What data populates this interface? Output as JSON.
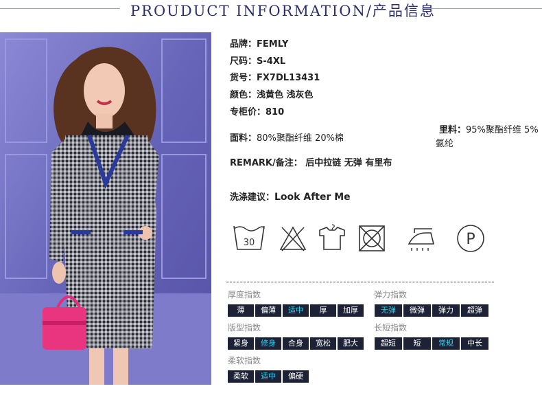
{
  "header": {
    "title": "PROUDUCT INFORMATION/产品信息"
  },
  "specs": [
    {
      "key": "品牌：",
      "value": "FEMLY"
    },
    {
      "key": "尺码：",
      "value": "S-4XL"
    },
    {
      "key": "货号：",
      "value": "FX7DL13431"
    },
    {
      "key": "颜色：",
      "value": "浅黄色 浅灰色"
    },
    {
      "key": "专柜价：",
      "value": "810"
    }
  ],
  "fabric": {
    "key": "面料：",
    "value": "80%聚酯纤维 20%棉"
  },
  "lining": {
    "key": "里料：",
    "value": "95%聚酯纤维 5%氨纶"
  },
  "remark": {
    "key": "REMARK/备注：",
    "value": "后中拉链 无弹 有里布"
  },
  "wash": {
    "key": "洗涤建议：",
    "value": "Look After Me"
  },
  "care_icons": [
    {
      "name": "wash-30-icon",
      "value": "30"
    },
    {
      "name": "no-bleach-icon"
    },
    {
      "name": "hang-dry-icon"
    },
    {
      "name": "no-tumble-dry-icon"
    },
    {
      "name": "iron-icon"
    },
    {
      "name": "dry-clean-icon",
      "value": "P"
    }
  ],
  "indices": {
    "thickness": {
      "title": "厚度指数",
      "options": [
        "薄",
        "偏薄",
        "适中",
        "厚",
        "加厚"
      ],
      "selected": "适中"
    },
    "elasticity": {
      "title": "弹力指数",
      "options": [
        "无弹",
        "微弹",
        "弹力",
        "超弹"
      ],
      "selected": "无弹"
    },
    "fit": {
      "title": "版型指数",
      "options": [
        "紧身",
        "修身",
        "合身",
        "宽松",
        "肥大"
      ],
      "selected": "修身"
    },
    "length": {
      "title": "长短指数",
      "options": [
        "超短",
        "短",
        "常规",
        "中长"
      ],
      "selected": "常规"
    },
    "softness": {
      "title": "柔软指数",
      "options": [
        "柔软",
        "适中",
        "偏硬"
      ],
      "selected": "适中"
    }
  },
  "colors": {
    "accent": "#2fd0ee",
    "chip_bg": "#1d2236",
    "title": "#2c2f6e",
    "photo_bg": "#6e6cc0"
  }
}
